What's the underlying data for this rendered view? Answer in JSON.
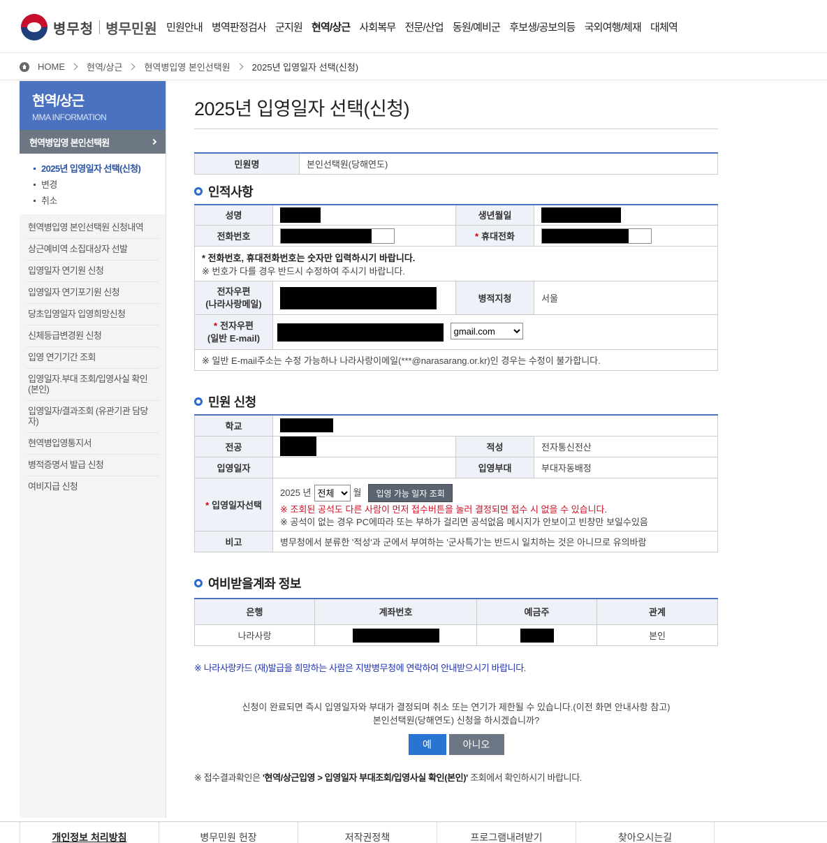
{
  "header": {
    "logo_text": "병무청",
    "logo_sub": "병무민원",
    "nav": [
      "민원안내",
      "병역판정검사",
      "군지원",
      "현역/상근",
      "사회복무",
      "전문/산업",
      "동원/예비군",
      "후보생/공보의등",
      "국외여행/체재",
      "대체역"
    ]
  },
  "breadcrumb": [
    "HOME",
    "현역/상근",
    "현역병입영 본인선택원",
    "2025년 입영일자 선택(신청)"
  ],
  "sidebar": {
    "title": "현역/상근",
    "subtitle": "MMA INFORMATION",
    "active": "현역병입영 본인선택원",
    "sub_items": [
      "2025년 입영일자 선택(신청)",
      "변경",
      "취소"
    ],
    "items": [
      "현역병입영 본인선택원 신청내역",
      "상근예비역 소집대상자 선발",
      "입영일자 연기원 신청",
      "입영일자 연기포기원 신청",
      "당초입영일자 입영희망신청",
      "신체등급변경원 신청",
      "입영 연기기간 조회",
      "입영일자.부대 조회/입영사실 확인(본인)",
      "입영일자/결과조회 (유관기관 담당자)",
      "현역병입영통지서",
      "병적증명서 발급 신청",
      "여비지급 신청"
    ]
  },
  "main": {
    "title": "2025년 입영일자 선택(신청)",
    "civil": {
      "label": "민원명",
      "value": "본인선택원(당해연도)"
    },
    "personal": {
      "title": "인적사항",
      "name_label": "성명",
      "birth_label": "생년월일",
      "phone_label": "전화번호",
      "mobile_label": "휴대전화",
      "note1": "* 전화번호, 휴대전화번호는 숫자만 입력하시기 바랍니다.",
      "note2": "※ 번호가 다를 경우 반드시 수정하여 주시기 바랍니다.",
      "epost_label1": "전자우편",
      "epost_label2": "(나라사랑메일)",
      "reg_label": "병적지청",
      "reg_value": "서울",
      "email_label1": "전자우편",
      "email_label2": "(일반 E-mail)",
      "email_domain": "gmail.com",
      "email_note": "※ 일반 E-mail주소는 수정 가능하나 나라사랑이메일(***@narasarang.or.kr)인 경우는 수정이 불가합니다."
    },
    "apply": {
      "title": "민원 신청",
      "school_label": "학교",
      "major_label": "전공",
      "aptitude_label": "적성",
      "aptitude_value": "전자통신전산",
      "date_label": "입영일자",
      "unit_label": "입영부대",
      "unit_value": "부대자동배정",
      "select_label": "입영일자선택",
      "year_text": "2025 년",
      "month_value": "전체",
      "month_suffix": "월",
      "lookup_button": "입영 가능 일자 조회",
      "warn1": "※ 조회된 공석도 다른 사람이 먼저 접수버튼을 눌러 결정되면 접수 시 없을 수 있습니다.",
      "warn2": "※ 공석이 없는 경우 PC에따라 또는 부하가 걸리면 공석없음 메시지가 안보이고 빈창만 보일수있음",
      "remark_label": "비고",
      "remark_value": "병무청에서 분류한 '적성'과 군에서 부여하는 '군사특기'는 반드시 일치하는 것은 아니므로 유의바람"
    },
    "account": {
      "title": "여비받을계좌 정보",
      "headers": [
        "은행",
        "계좌번호",
        "예금주",
        "관계"
      ],
      "bank": "나라사랑",
      "relation": "본인"
    },
    "card_notice": "※ 나라사랑카드 (재)발급을 희망하는 사람은 지방병무청에 연락하여 안내받으시기 바랍니다.",
    "confirm1": "신청이 완료되면 즉시 입영일자와 부대가 결정되며 취소 또는 연기가 제한될 수 있습니다.(이전 화면 안내사항 참고)",
    "confirm2": "본인선택원(당해연도) 신청을 하시겠습니까?",
    "yes": "예",
    "no": "아니오",
    "final_prefix": "※ 접수결과확인은 ",
    "final_bold": "'현역/상근입영 > 입영일자 부대조회/입영사실 확인(본인)'",
    "final_suffix": " 조회에서 확인하시기 바랍니다."
  },
  "footer": [
    "개인정보 처리방침",
    "병무민원 헌장",
    "저작권정책",
    "프로그램내려받기",
    "찾아오시는길"
  ]
}
